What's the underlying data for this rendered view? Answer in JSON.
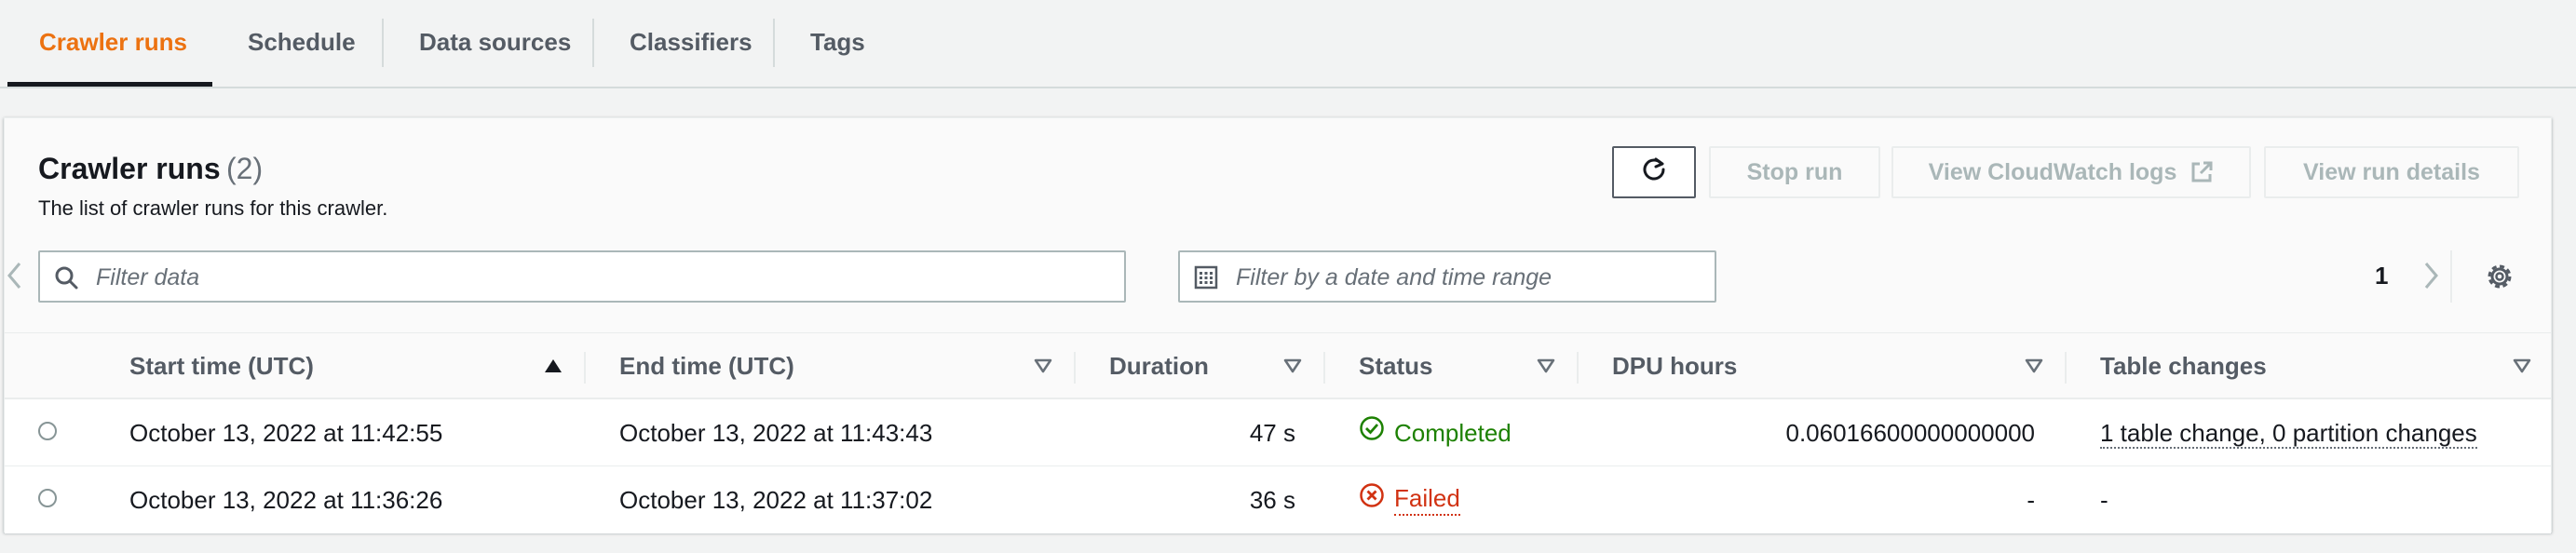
{
  "tabs": [
    {
      "label": "Crawler runs",
      "active": true
    },
    {
      "label": "Schedule"
    },
    {
      "label": "Data sources"
    },
    {
      "label": "Classifiers"
    },
    {
      "label": "Tags"
    }
  ],
  "panel": {
    "title": "Crawler runs",
    "count": "(2)",
    "description": "The list of crawler runs for this crawler."
  },
  "actions": {
    "refresh_icon": "refresh-icon",
    "stop_run": "Stop run",
    "view_cloudwatch_logs": "View CloudWatch logs",
    "view_run_details": "View run details"
  },
  "filters": {
    "text_placeholder": "Filter data",
    "date_placeholder": "Filter by a date and time range"
  },
  "pagination": {
    "current_page": "1"
  },
  "table": {
    "columns": [
      "Start time (UTC)",
      "End time (UTC)",
      "Duration",
      "Status",
      "DPU hours",
      "Table changes"
    ],
    "rows": [
      {
        "start": "October 13, 2022 at 11:42:55",
        "end": "October 13, 2022 at 11:43:43",
        "duration": "47 s",
        "status": "Completed",
        "dpu": "0.06016600000000000",
        "changes": "1 table change, 0 partition changes"
      },
      {
        "start": "October 13, 2022 at 11:36:26",
        "end": "October 13, 2022 at 11:37:02",
        "duration": "36 s",
        "status": "Failed",
        "dpu": "-",
        "changes": "-"
      }
    ]
  },
  "colors": {
    "accent": "#ec7211",
    "success": "#1d8102",
    "error": "#d13212"
  }
}
